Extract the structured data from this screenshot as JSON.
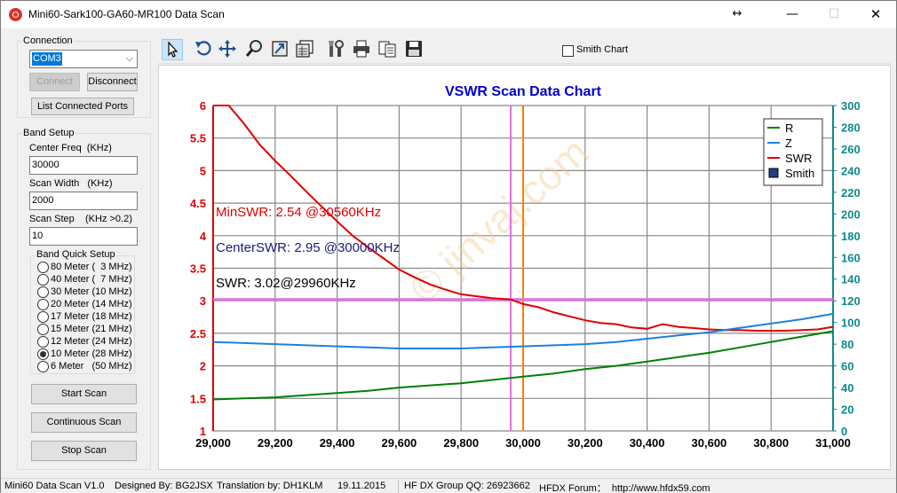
{
  "window": {
    "title": "Mini60-Sark100-GA60-MR100 Data Scan",
    "resize_icon": "↔",
    "minimize_icon": "—",
    "maximize_icon": "☐",
    "close_icon": "✕"
  },
  "connection": {
    "group_title": "Connection",
    "port_value": "COM3",
    "connect_label": "Connect",
    "disconnect_label": "Disconnect",
    "list_ports_label": "List Connected Ports"
  },
  "band_setup": {
    "group_title": "Band Setup",
    "center_freq_label": "Center Freq  (KHz)",
    "center_freq_value": "30000",
    "scan_width_label": "Scan Width   (KHz)",
    "scan_width_value": "2000",
    "scan_step_label": "Scan Step",
    "scan_step_hint": "(KHz >0.2)",
    "scan_step_value": "10",
    "quick_setup_title": "Band Quick Setup",
    "bands": [
      {
        "label": "80 Meter (  3 MHz)",
        "selected": false
      },
      {
        "label": "40 Meter (  7 MHz)",
        "selected": false
      },
      {
        "label": "30 Meter (10 MHz)",
        "selected": false
      },
      {
        "label": "20 Meter (14 MHz)",
        "selected": false
      },
      {
        "label": "17 Meter (18 MHz)",
        "selected": false
      },
      {
        "label": "15 Meter (21 MHz)",
        "selected": false
      },
      {
        "label": "12 Meter (24 MHz)",
        "selected": false
      },
      {
        "label": "10 Meter (28 MHz)",
        "selected": true
      },
      {
        "label": "6 Meter   (50 MHz)",
        "selected": false
      }
    ],
    "start_scan_label": "Start Scan",
    "continuous_scan_label": "Continuous Scan",
    "stop_scan_label": "Stop Scan"
  },
  "toolbar": {
    "tools": [
      "pointer-icon",
      "rotate-icon",
      "pan-icon",
      "zoom-icon",
      "zoom-fit-icon",
      "chart-data-icon",
      "tools-icon",
      "print-icon",
      "copy-icon",
      "save-icon"
    ],
    "smith_chart_label": "Smith Chart",
    "smith_chart_checked": false
  },
  "chart_data": {
    "type": "line",
    "title": "VSWR Scan Data Chart",
    "xlabel": "",
    "x_ticks": [
      "29,000",
      "29,200",
      "29,400",
      "29,600",
      "29,800",
      "30,000",
      "30,200",
      "30,400",
      "30,600",
      "30,800",
      "31,000"
    ],
    "xlim": [
      29000,
      31000
    ],
    "y_left_ticks": [
      "1",
      "1.5",
      "2",
      "2.5",
      "3",
      "3.5",
      "4",
      "4.5",
      "5",
      "5.5",
      "6"
    ],
    "ylim_left": [
      1,
      6
    ],
    "y_right_ticks": [
      "0",
      "20",
      "40",
      "60",
      "80",
      "100",
      "120",
      "140",
      "160",
      "180",
      "200",
      "220",
      "240",
      "260",
      "280",
      "300"
    ],
    "ylim_right": [
      0,
      300
    ],
    "grid": true,
    "legend_position": "top-right",
    "legend": [
      {
        "name": "R",
        "color": "#008000",
        "kind": "line"
      },
      {
        "name": "Z",
        "color": "#1e7fe0",
        "kind": "line"
      },
      {
        "name": "SWR",
        "color": "#e00000",
        "kind": "line"
      },
      {
        "name": "Smith",
        "color": "#1f3f7f",
        "kind": "box"
      }
    ],
    "series": [
      {
        "name": "SWR",
        "axis": "left",
        "color": "#e00000",
        "x": [
          29000,
          29020,
          29050,
          29100,
          29150,
          29200,
          29250,
          29300,
          29350,
          29400,
          29450,
          29500,
          29550,
          29600,
          29650,
          29700,
          29750,
          29800,
          29850,
          29900,
          29960,
          30000,
          30050,
          30100,
          30150,
          30200,
          30250,
          30300,
          30350,
          30400,
          30450,
          30500,
          30550,
          30600,
          30650,
          30700,
          30750,
          30800,
          30850,
          30900,
          30950,
          31000
        ],
        "values": [
          6.0,
          6.0,
          6.0,
          5.72,
          5.4,
          5.15,
          4.92,
          4.68,
          4.45,
          4.22,
          4.0,
          3.82,
          3.65,
          3.48,
          3.36,
          3.25,
          3.17,
          3.1,
          3.07,
          3.04,
          3.02,
          2.95,
          2.9,
          2.82,
          2.76,
          2.7,
          2.66,
          2.64,
          2.59,
          2.57,
          2.64,
          2.6,
          2.58,
          2.56,
          2.55,
          2.55,
          2.54,
          2.54,
          2.54,
          2.55,
          2.56,
          2.6
        ]
      },
      {
        "name": "Z",
        "axis": "right",
        "color": "#1e7fe0",
        "x": [
          29000,
          29100,
          29200,
          29300,
          29400,
          29500,
          29600,
          29700,
          29800,
          29900,
          30000,
          30100,
          30200,
          30300,
          30400,
          30500,
          30600,
          30700,
          30800,
          30900,
          31000
        ],
        "values": [
          82,
          81,
          80,
          79,
          78,
          77,
          76,
          76,
          76,
          77,
          78,
          79,
          80,
          82,
          85,
          88,
          91,
          95,
          99,
          103,
          108
        ]
      },
      {
        "name": "R",
        "axis": "right",
        "color": "#008000",
        "x": [
          29000,
          29100,
          29200,
          29300,
          29400,
          29500,
          29600,
          29700,
          29800,
          29900,
          30000,
          30100,
          30200,
          30300,
          30400,
          30500,
          30600,
          30700,
          30800,
          30900,
          31000
        ],
        "values": [
          29,
          30,
          31,
          33,
          35,
          37,
          40,
          42,
          44,
          47,
          50,
          53,
          57,
          60,
          64,
          68,
          72,
          77,
          82,
          87,
          92
        ]
      }
    ],
    "markers": {
      "min_swr_freq": 29960,
      "center_freq": 30000,
      "swr_level": 3.02
    },
    "annotations": [
      {
        "text": "MinSWR: 2.54 @30560KHz",
        "color": "#e00000"
      },
      {
        "text": "CenterSWR: 2.95 @30000KHz",
        "color": "#1a1a80"
      },
      {
        "text": "SWR: 3.02@29960KHz",
        "color": "#000000"
      }
    ],
    "watermark": "© jinvaj.com",
    "colors": {
      "left_axis": "#e00000",
      "right_axis": "#0e8a8a",
      "title": "#0000cc",
      "grid": "#888888",
      "marker_v1": "#e070e0",
      "marker_v2": "#ff8000",
      "marker_h": "#e070e0"
    }
  },
  "status_bar": {
    "version": "Mini60 Data Scan V1.0",
    "designer": "Designed By: BG2JSX",
    "translator": "Translation by: DH1KLM",
    "date": "19.11.2015",
    "group": "HF DX Group QQ: 26923662",
    "forum": "HFDX Forum：  http://www.hfdx59.com"
  }
}
